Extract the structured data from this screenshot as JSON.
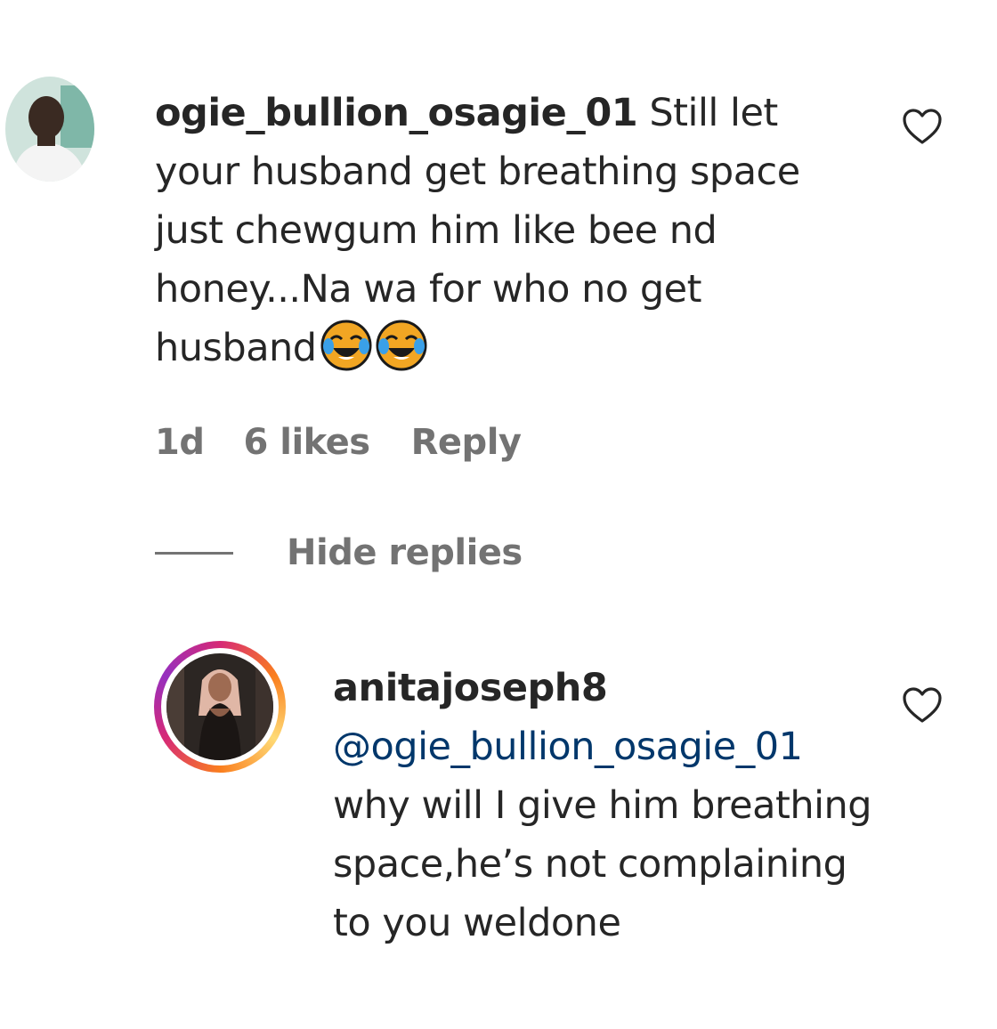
{
  "comment": {
    "username": "ogie_bullion_osagie_01",
    "text": "Still let your husband get breathing space just chewgum him like bee nd honey...Na wa for who no get husband",
    "time": "1d",
    "likes": "6 likes",
    "reply_label": "Reply",
    "emoji_name": "face-with-tears-of-joy-icon"
  },
  "thread": {
    "hide_replies_label": "Hide replies"
  },
  "reply": {
    "username": "anitajoseph8",
    "mention": "@ogie_bullion_osagie_01",
    "text": "why will I give him breathing space,he’s not complaining to you weldone"
  },
  "colors": {
    "text": "#262626",
    "muted": "#737373",
    "mention": "#00376b",
    "story_ring_start": "#d62976",
    "story_ring_end": "#fa7e1e"
  }
}
